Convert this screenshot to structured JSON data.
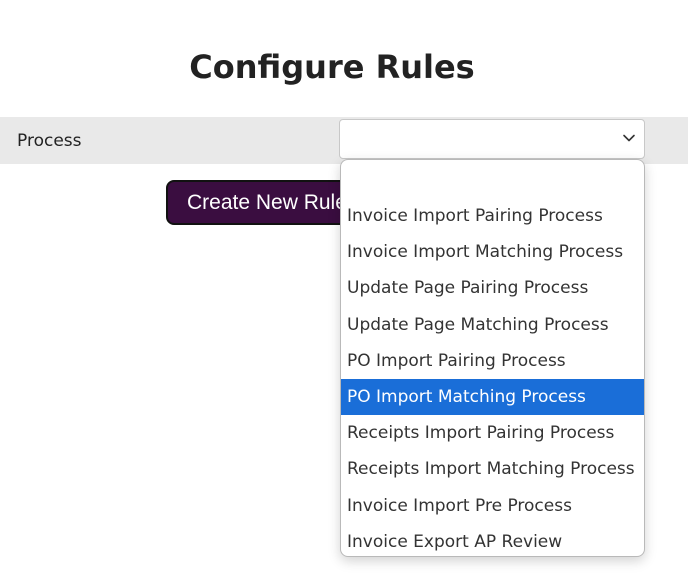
{
  "page": {
    "title": "Configure Rules"
  },
  "process": {
    "label": "Process",
    "selected_value": "",
    "chevron_icon": "chevron-down-icon"
  },
  "actions": {
    "create_new_rule_label": "Create New Rule"
  },
  "dropdown": {
    "highlighted_index": 5,
    "highlight_color": "#1a6ed8",
    "options": [
      "Invoice Import Pairing Process",
      "Invoice Import Matching Process",
      "Update Page Pairing Process",
      "Update Page Matching Process",
      "PO Import Pairing Process",
      "PO Import Matching Process",
      "Receipts Import Pairing Process",
      "Receipts Import Matching Process",
      "Invoice Import Pre Process",
      "Invoice Export AP Review"
    ]
  },
  "colors": {
    "button_background": "#3a0d40",
    "row_background": "#e9e9e9"
  }
}
